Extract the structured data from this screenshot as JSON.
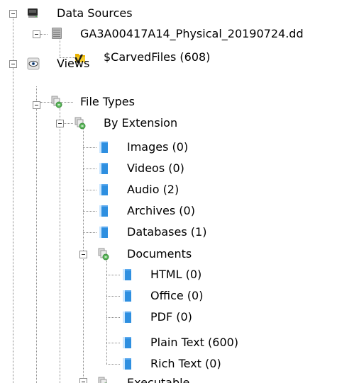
{
  "tree": {
    "data_sources": {
      "label": "Data Sources",
      "image": {
        "label": "GA3A00417A14_Physical_20190724.dd",
        "carved": {
          "label": "$CarvedFiles (608)"
        }
      }
    },
    "views": {
      "label": "Views",
      "file_types": {
        "label": "File Types",
        "by_extension": {
          "label": "By Extension",
          "images": "Images (0)",
          "videos": "Videos (0)",
          "audio": "Audio (2)",
          "archives": "Archives (0)",
          "databases": "Databases (1)",
          "documents": {
            "label": "Documents",
            "html": "HTML (0)",
            "office": "Office (0)",
            "pdf": "PDF (0)",
            "plain_text": "Plain Text (600)",
            "rich_text": "Rich Text (0)"
          },
          "next_partial": "Executable"
        }
      }
    }
  },
  "colors": {
    "tree_line": "#8a8a8a",
    "expander_border": "#8c8c8c",
    "file_icon": "#2e8fe0",
    "folder_icon": "#f0c020",
    "text": "#000000"
  },
  "icons": {
    "data_sources": "disk-drive-icon",
    "image": "disk-image-icon",
    "carved": "carved-folder-icon",
    "views": "eye-icon",
    "groups": "file-type-group-icon",
    "files": "file-category-icon"
  }
}
